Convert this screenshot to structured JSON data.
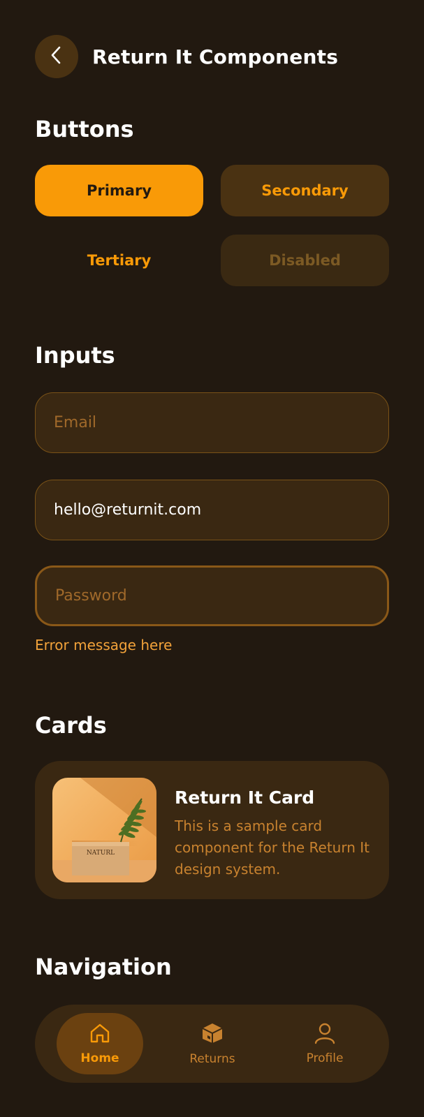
{
  "header": {
    "title": "Return It Components"
  },
  "sections": {
    "buttons": "Buttons",
    "inputs": "Inputs",
    "cards": "Cards",
    "navigation": "Navigation"
  },
  "buttons": {
    "primary": "Primary",
    "secondary": "Secondary",
    "tertiary": "Tertiary",
    "disabled": "Disabled"
  },
  "inputs": {
    "email_placeholder": "Email",
    "email_filled_value": "hello@returnit.com",
    "password_placeholder": "Password",
    "error_message": "Error message here"
  },
  "card": {
    "title": "Return It Card",
    "description": "This is a sample card component for the Return It design system.",
    "image_box_label": "NATURL"
  },
  "nav": {
    "items": [
      {
        "label": "Home",
        "icon": "home-icon",
        "active": true
      },
      {
        "label": "Returns",
        "icon": "box-icon",
        "active": false
      },
      {
        "label": "Profile",
        "icon": "person-icon",
        "active": false
      }
    ]
  },
  "colors": {
    "background": "#221910",
    "accent": "#f99a07",
    "surface": "#3a2812",
    "muted_text": "#c8822f"
  }
}
